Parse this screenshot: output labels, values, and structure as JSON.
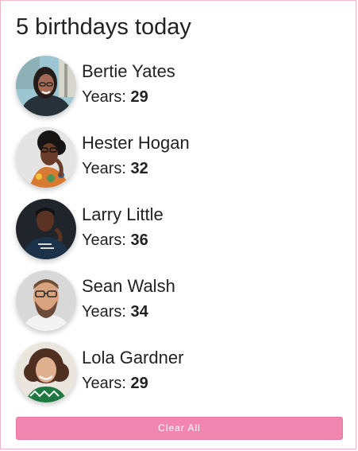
{
  "header": {
    "title": "5 birthdays today"
  },
  "people": [
    {
      "name": "Bertie Yates",
      "years_label": "Years:",
      "age": "29",
      "avatar": "woman-glasses-city-avatar"
    },
    {
      "name": "Hester Hogan",
      "years_label": "Years:",
      "age": "32",
      "avatar": "woman-curly-hair-avatar"
    },
    {
      "name": "Larry Little",
      "years_label": "Years:",
      "age": "36",
      "avatar": "man-dark-background-avatar"
    },
    {
      "name": "Sean Walsh",
      "years_label": "Years:",
      "age": "34",
      "avatar": "man-beard-glasses-avatar"
    },
    {
      "name": "Lola Gardner",
      "years_label": "Years:",
      "age": "29",
      "avatar": "woman-smiling-curly-avatar"
    }
  ],
  "actions": {
    "clear_label": "Clear All"
  },
  "colors": {
    "accent": "#f187b1",
    "border": "#e7b7c6",
    "text": "#222222"
  }
}
